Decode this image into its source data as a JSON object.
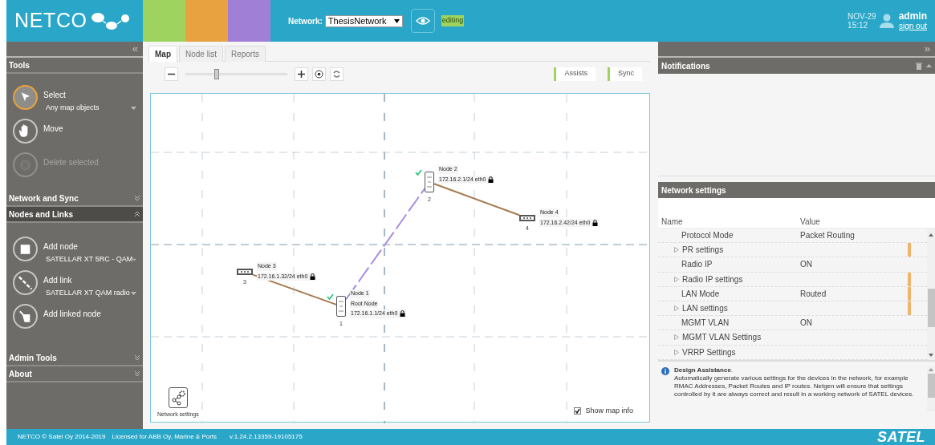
{
  "header": {
    "logo": "NETCO",
    "color_tabs": [
      {
        "color": "#9fd35f"
      },
      {
        "color": "#e8a23f"
      },
      {
        "color": "#a07fd6"
      }
    ],
    "network_label": "Network:",
    "network_select": "ThesisNetwork",
    "mode_badge": "editing",
    "date": "NOV-29",
    "time": "15:12",
    "user": "admin",
    "sign_out": "sign out"
  },
  "left_panel": {
    "collapse": "«",
    "tools": {
      "title": "Tools",
      "items": [
        {
          "kind": "select",
          "label": "Select",
          "option": "Any map objects",
          "selected": true,
          "disabled": false
        },
        {
          "kind": "move",
          "label": "Move",
          "selected": false,
          "disabled": false
        },
        {
          "kind": "delete",
          "label": "Delete selected",
          "selected": false,
          "disabled": true
        }
      ]
    },
    "sections": [
      {
        "title": "Network and Sync",
        "expanded": false
      },
      {
        "title": "Nodes and Links",
        "expanded": true,
        "items": [
          {
            "kind": "add-node",
            "label": "Add node",
            "option": "SATELLAR XT 5RC - QAM"
          },
          {
            "kind": "add-link",
            "label": "Add link",
            "option": "SATELLAR XT QAM radio"
          },
          {
            "kind": "add-linked-node",
            "label": "Add linked node"
          }
        ]
      },
      {
        "title": "Admin Tools",
        "expanded": false
      },
      {
        "title": "About",
        "expanded": false
      }
    ]
  },
  "center": {
    "tabs": [
      {
        "label": "Map",
        "selected": true
      },
      {
        "label": "Node list",
        "selected": false
      },
      {
        "label": "Reports",
        "selected": false
      }
    ],
    "zoom": {
      "level": 0.3
    },
    "toolbar_buttons": [
      "Assists",
      "Sync"
    ],
    "map": {
      "nodes": [
        {
          "kind": "radio",
          "name": "Node 1",
          "role": "Root Node",
          "address": "172.16.1.1/24 eth0",
          "number": "1",
          "checked": true
        },
        {
          "kind": "radio",
          "name": "Node 2",
          "address": "172.16.2.1/24 eth0",
          "number": "2",
          "checked": true
        },
        {
          "kind": "device",
          "name": "Node 3",
          "address": "172.16.1.32/24 eth0",
          "number": "3",
          "checked": false
        },
        {
          "kind": "device",
          "name": "Node 4",
          "address": "172.16.2.42/24 eth0",
          "number": "4",
          "checked": false
        }
      ],
      "links": [
        {
          "kind": "wired"
        },
        {
          "kind": "radio"
        },
        {
          "kind": "wired"
        }
      ],
      "settings_button": "Network settings",
      "show_info": {
        "label": "Show map info",
        "checked": true
      }
    }
  },
  "right_panel": {
    "expand": "»",
    "notifications": {
      "title": "Notifications"
    },
    "network_settings": {
      "title": "Network settings",
      "columns": [
        "Name",
        "Value"
      ],
      "rows": [
        {
          "name": "Protocol Mode",
          "value": "Packet Routing",
          "expandable": false,
          "modified": false
        },
        {
          "name": "PR settings",
          "expandable": true,
          "modified": true
        },
        {
          "name": "Radio IP",
          "value": "ON",
          "expandable": false,
          "modified": false
        },
        {
          "name": "Radio IP settings",
          "expandable": true,
          "modified": true
        },
        {
          "name": "LAN Mode",
          "value": "Routed",
          "expandable": false,
          "modified": true
        },
        {
          "name": "LAN settings",
          "expandable": true,
          "modified": true
        },
        {
          "name": "MGMT VLAN",
          "value": "ON",
          "expandable": false,
          "modified": false
        },
        {
          "name": "MGMT VLAN Settings",
          "expandable": true,
          "modified": false
        },
        {
          "name": "VRRP Settings",
          "expandable": true,
          "modified": false
        }
      ],
      "info": {
        "title": "**Design Assistance**.",
        "text": "Automatically generate various settings for the devices in the network, for example RMAC Addresses, Packet Routes and IP routes. Netgen will ensure that settings controlled by it are always correct and result in a working network of SATEL devices."
      }
    }
  },
  "footer": {
    "copyright": "NETCO © Satel Oy 2014-2019",
    "license": "Licensed for ABB Oy, Marine & Ports",
    "version": "v.1.24.2.13359-19105175",
    "brand": "SATEL"
  }
}
